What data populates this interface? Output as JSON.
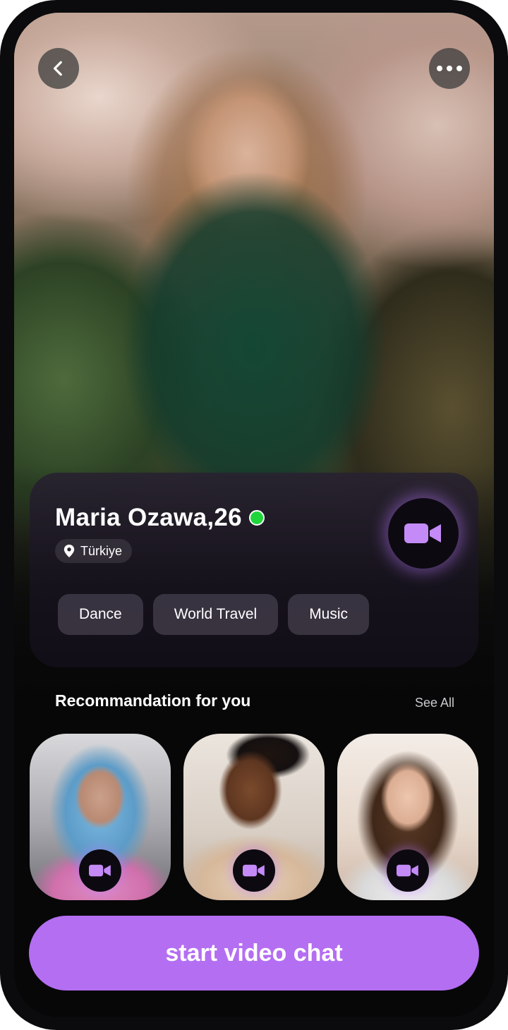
{
  "profile": {
    "name": "Maria Ozawa,26",
    "location": "Türkiye",
    "tags": [
      "Dance",
      "World Travel",
      "Music"
    ]
  },
  "icons": {
    "back": "chevron-left-icon",
    "more": "more-dots-icon",
    "location": "location-pin-icon",
    "video": "video-camera-icon"
  },
  "recommendations": {
    "title": "Recommandation for you",
    "see_all": "See All"
  },
  "start_button": {
    "label": "start video chat"
  },
  "colors": {
    "accent": "#b46ef2",
    "online": "#1ed63a",
    "video_icon": "#c48af7"
  }
}
